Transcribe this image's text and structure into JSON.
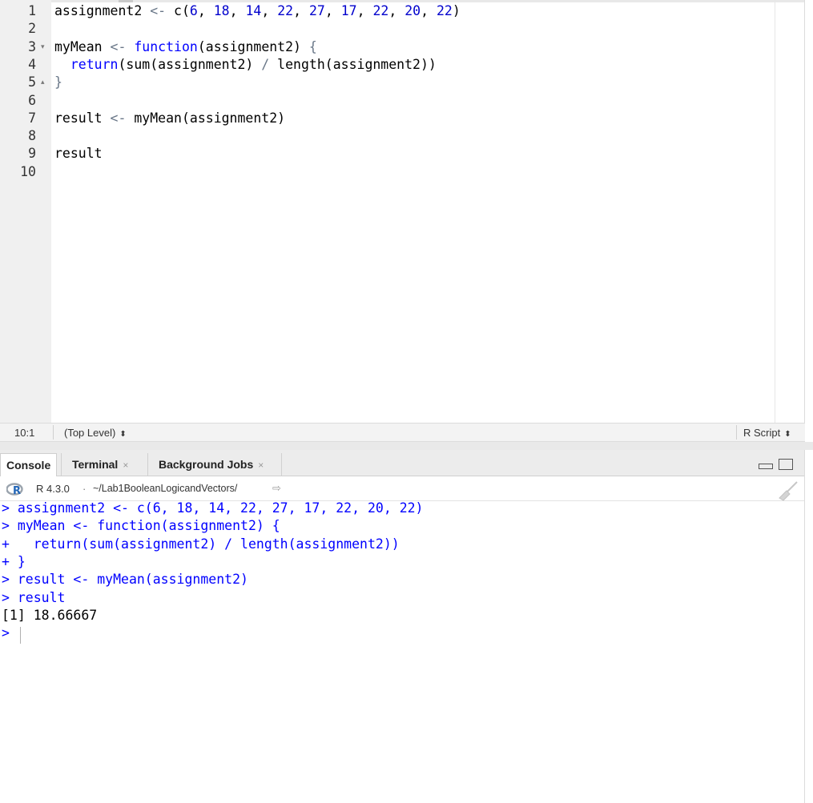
{
  "editor": {
    "lines": [
      {
        "num": "1",
        "code": [
          [
            "plain",
            "assignment2 "
          ],
          [
            "op",
            "<-"
          ],
          [
            "plain",
            " c("
          ],
          [
            "num",
            "6"
          ],
          [
            "plain",
            ", "
          ],
          [
            "num",
            "18"
          ],
          [
            "plain",
            ", "
          ],
          [
            "num",
            "14"
          ],
          [
            "plain",
            ", "
          ],
          [
            "num",
            "22"
          ],
          [
            "plain",
            ", "
          ],
          [
            "num",
            "27"
          ],
          [
            "plain",
            ", "
          ],
          [
            "num",
            "17"
          ],
          [
            "plain",
            ", "
          ],
          [
            "num",
            "22"
          ],
          [
            "plain",
            ", "
          ],
          [
            "num",
            "20"
          ],
          [
            "plain",
            ", "
          ],
          [
            "num",
            "22"
          ],
          [
            "plain",
            ")"
          ]
        ]
      },
      {
        "num": "2",
        "code": []
      },
      {
        "num": "3",
        "fold": "▾",
        "code": [
          [
            "plain",
            "myMean "
          ],
          [
            "op",
            "<-"
          ],
          [
            "plain",
            " "
          ],
          [
            "kw",
            "function"
          ],
          [
            "plain",
            "(assignment2) "
          ],
          [
            "op",
            "{"
          ]
        ]
      },
      {
        "num": "4",
        "code": [
          [
            "plain",
            "  "
          ],
          [
            "kw",
            "return"
          ],
          [
            "plain",
            "(sum(assignment2) "
          ],
          [
            "op",
            "/"
          ],
          [
            "plain",
            " length(assignment2))"
          ]
        ]
      },
      {
        "num": "5",
        "fold": "▴",
        "code": [
          [
            "op",
            "}"
          ]
        ]
      },
      {
        "num": "6",
        "code": []
      },
      {
        "num": "7",
        "code": [
          [
            "plain",
            "result "
          ],
          [
            "op",
            "<-"
          ],
          [
            "plain",
            " myMean(assignment2)"
          ]
        ]
      },
      {
        "num": "8",
        "code": []
      },
      {
        "num": "9",
        "code": [
          [
            "plain",
            "result"
          ]
        ]
      },
      {
        "num": "10",
        "code": []
      }
    ]
  },
  "status": {
    "position": "10:1",
    "scope": "(Top Level)",
    "file_type": "R Script",
    "updown": "⬍"
  },
  "tabs": [
    {
      "label": "Console",
      "active": true
    },
    {
      "label": "Terminal",
      "close": "×"
    },
    {
      "label": "Background Jobs",
      "close": "×"
    }
  ],
  "console_info": {
    "r_version": "R 4.3.0",
    "separator": "·",
    "path": "~/Lab1BooleanLogicandVectors/",
    "goto": "⇨"
  },
  "console": {
    "lines": [
      {
        "type": "in",
        "text": "> assignment2 <- c(6, 18, 14, 22, 27, 17, 22, 20, 22)"
      },
      {
        "type": "in",
        "text": "> myMean <- function(assignment2) {"
      },
      {
        "type": "in",
        "text": "+   return(sum(assignment2) / length(assignment2))"
      },
      {
        "type": "in",
        "text": "+ }"
      },
      {
        "type": "in",
        "text": "> result <- myMean(assignment2)"
      },
      {
        "type": "in",
        "text": "> result"
      },
      {
        "type": "out",
        "text": "[1] 18.66667"
      },
      {
        "type": "in",
        "text": "> "
      }
    ]
  },
  "colors": {
    "keyword": "#0000ff",
    "number": "#0000cd",
    "operator": "#687687",
    "console_input": "#0000ff"
  },
  "icons": [
    "r-logo-icon",
    "goto-directory-icon",
    "minimize-icon",
    "maximize-icon",
    "clear-console-broom-icon",
    "close-tab-icon",
    "dropdown-updown-icon"
  ]
}
